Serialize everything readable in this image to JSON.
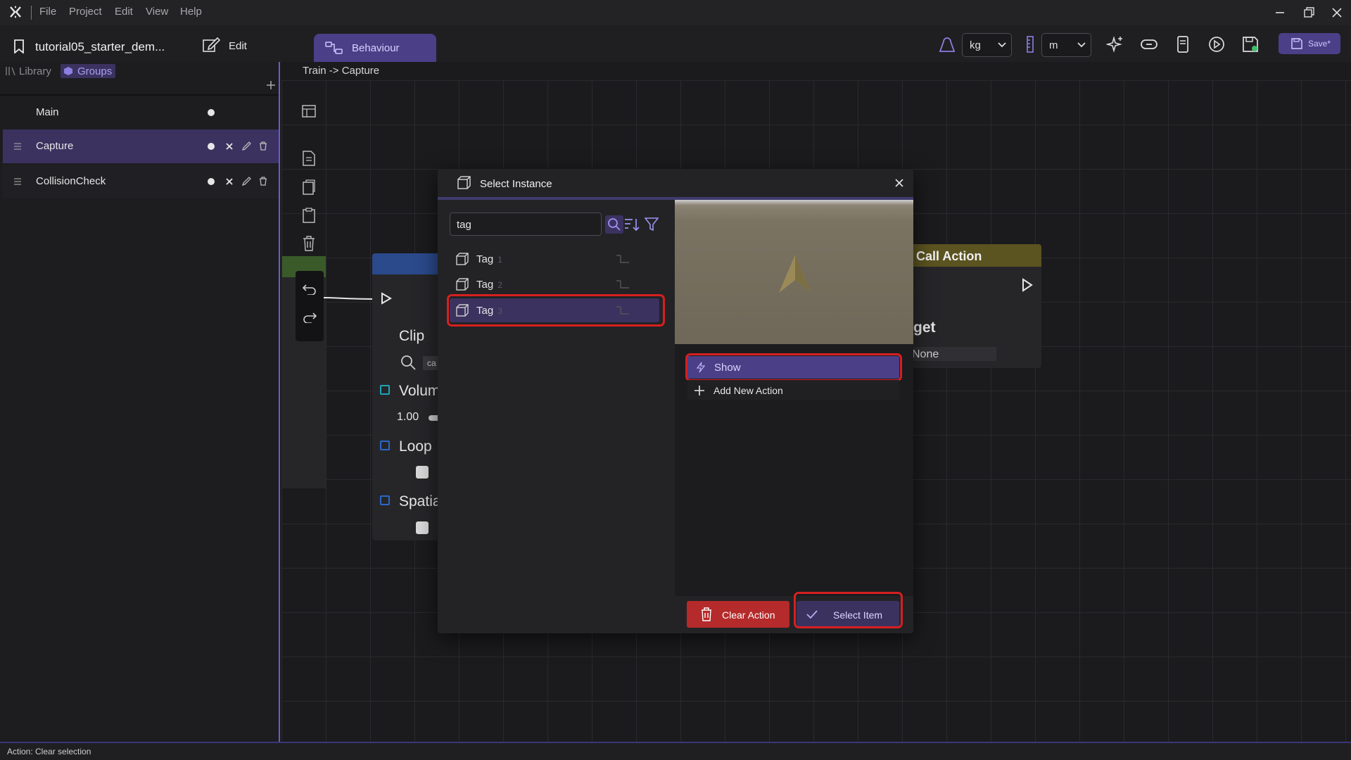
{
  "titlebar": {
    "menus": [
      "File",
      "Project",
      "Edit",
      "View",
      "Help"
    ]
  },
  "toolbar": {
    "project_name": "tutorial05_starter_dem...",
    "edit_label": "Edit",
    "behaviour_tab": "Behaviour",
    "mass_unit": "kg",
    "length_unit": "m",
    "save_label": "Save*"
  },
  "left_panel": {
    "tabs": [
      "Library",
      "Groups"
    ],
    "groups": [
      {
        "name": "Main"
      },
      {
        "name": "Capture"
      },
      {
        "name": "CollisionCheck"
      }
    ]
  },
  "canvas": {
    "breadcrumb": "Train -> Capture",
    "node_left": {
      "clip_label": "Clip",
      "search_value": "ca",
      "volume_label": "Volum",
      "volume_value": "1.00",
      "loop_label": "Loop",
      "spatial_label": "Spatia"
    },
    "node_right": {
      "title": "Call Action",
      "target_label": "get",
      "target_value": "None"
    }
  },
  "dialog": {
    "title": "Select Instance",
    "search_value": "tag",
    "items": [
      {
        "label": "Tag",
        "index": "1"
      },
      {
        "label": "Tag",
        "index": "2"
      },
      {
        "label": "Tag",
        "index": "3"
      }
    ],
    "actions": [
      {
        "label": "Show"
      }
    ],
    "add_action_label": "Add New Action",
    "clear_button": "Clear Action",
    "select_button": "Select Item"
  },
  "statusbar": {
    "text": "Action: Clear selection"
  },
  "colors": {
    "accent": "#6b5ccf",
    "selected_row": "#3b3260",
    "highlight_red": "#d71f1f",
    "danger": "#b52a2a",
    "call_action_header": "#5b5320"
  }
}
